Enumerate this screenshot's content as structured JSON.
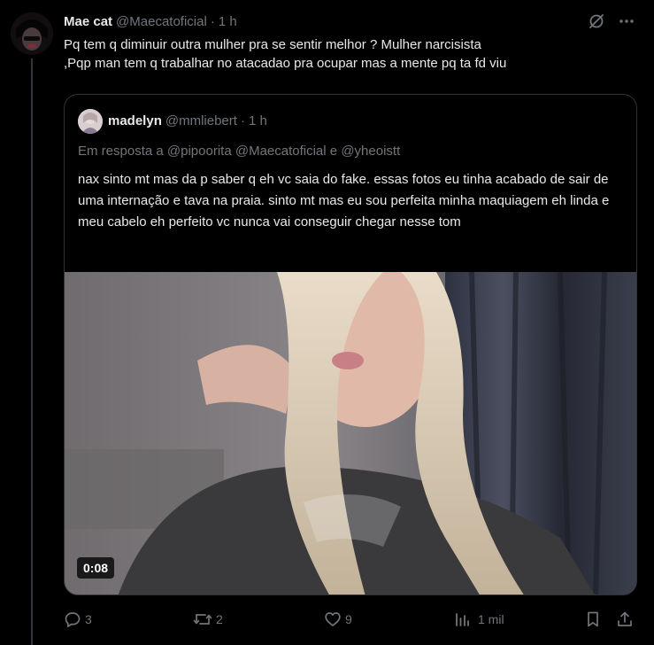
{
  "tweet": {
    "author": {
      "display_name": "Mae cat",
      "handle": "@Maecatoficial",
      "separator": "·",
      "time": "1 h"
    },
    "text": "Pq tem q diminuir outra mulher pra se sentir melhor ? Mulher narcisista\n,Pqp man tem q trabalhar no atacadao pra ocupar mas a mente pq ta fd viu",
    "header_icons": [
      "grok-icon",
      "more-icon"
    ]
  },
  "quote": {
    "author": {
      "display_name": "madelyn",
      "handle": "@mmliebert",
      "separator": "·",
      "time": "1 h"
    },
    "reply_prefix": "Em resposta a",
    "mentions": [
      "@pipoorita",
      "@Maecatoficial",
      "@yheoistt"
    ],
    "reply_joiner": "e",
    "text": "nax sinto mt mas da p saber q eh vc saia do fake. essas fotos eu tinha acabado de sair de uma internação e tava na praia. sinto mt mas eu sou perfeita minha maquiagem eh linda e meu cabelo eh perfeito vc nunca vai conseguir chegar nesse tom",
    "video": {
      "duration": "0:08"
    }
  },
  "actions": {
    "reply": {
      "icon": "reply-icon",
      "count": "3"
    },
    "repost": {
      "icon": "repost-icon",
      "count": "2"
    },
    "like": {
      "icon": "heart-icon",
      "count": "9"
    },
    "views": {
      "icon": "views-icon",
      "count": "1 mil"
    },
    "bookmark": {
      "icon": "bookmark-icon"
    },
    "share": {
      "icon": "share-icon"
    }
  },
  "colors": {
    "background": "#000000",
    "text_primary": "#e7e9ea",
    "text_secondary": "#71767b",
    "border": "#2f3336",
    "thread_line": "#333639"
  }
}
